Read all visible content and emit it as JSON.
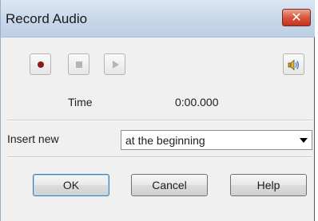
{
  "window": {
    "title": "Record Audio",
    "close_icon": "close-icon"
  },
  "transport": {
    "record_icon": "record-icon",
    "stop_icon": "stop-icon",
    "play_icon": "play-icon",
    "volume_icon": "speaker-volume-icon"
  },
  "time": {
    "label": "Time",
    "value": "0:00.000"
  },
  "insert": {
    "label": "Insert new",
    "selected": "at the beginning"
  },
  "buttons": {
    "ok": "OK",
    "cancel": "Cancel",
    "help": "Help"
  },
  "colors": {
    "record": "#8a1a1a",
    "close_button": "#d9553c",
    "titlebar": "#c7d7ea"
  }
}
